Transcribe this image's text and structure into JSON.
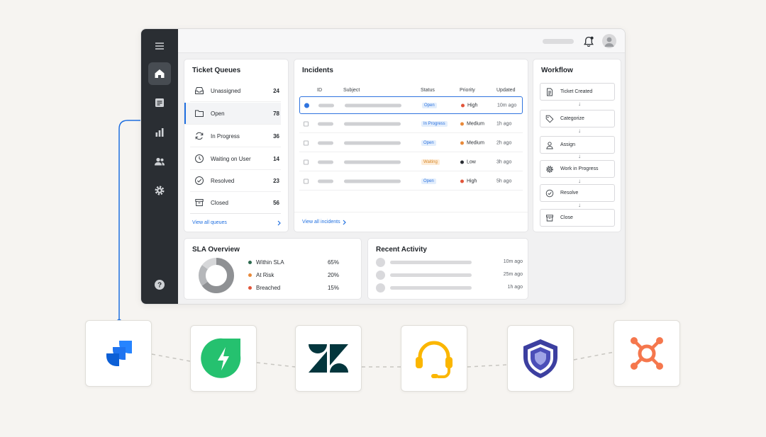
{
  "queues": {
    "title": "Ticket Queues",
    "items": [
      {
        "label": "Unassigned",
        "count": "24"
      },
      {
        "label": "Open",
        "count": "78"
      },
      {
        "label": "In Progress",
        "count": "36"
      },
      {
        "label": "Waiting on User",
        "count": "14"
      },
      {
        "label": "Resolved",
        "count": "23"
      },
      {
        "label": "Closed",
        "count": "56"
      }
    ],
    "view_all": "View all queues"
  },
  "incidents": {
    "title": "Incidents",
    "columns": [
      "ID",
      "Subject",
      "Status",
      "Priority",
      "Updated"
    ],
    "rows": [
      {
        "status": "Open",
        "priority": "High",
        "updated": "10m ago"
      },
      {
        "status": "In Progress",
        "priority": "Medium",
        "updated": "1h ago"
      },
      {
        "status": "Open",
        "priority": "Medium",
        "updated": "2h ago"
      },
      {
        "status": "Waiting",
        "priority": "Low",
        "updated": "3h ago"
      },
      {
        "status": "Open",
        "priority": "High",
        "updated": "5h ago"
      }
    ],
    "view_all": "View all incidents"
  },
  "workflow": {
    "title": "Workflow",
    "steps": [
      "Ticket Created",
      "Categorize",
      "Assign",
      "Work in Progress",
      "Resolve",
      "Close"
    ]
  },
  "sla": {
    "title": "SLA Overview",
    "items": [
      {
        "label": "Within SLA",
        "value": "65%",
        "fraction": 0.65,
        "color": "#2d6a4f"
      },
      {
        "label": "At Risk",
        "value": "20%",
        "fraction": 0.2,
        "color": "#e8893a"
      },
      {
        "label": "Breached",
        "value": "15%",
        "fraction": 0.15,
        "color": "#e2553a"
      }
    ]
  },
  "activity": {
    "title": "Recent Activity",
    "times": [
      "10m ago",
      "25m ago",
      "1h ago"
    ]
  },
  "colors": {
    "accent": "#1f6fe0",
    "sidebar": "#2a2e33",
    "priority_high": "#e2553a",
    "priority_medium": "#e8893a",
    "priority_low": "#2a2e33"
  },
  "integrations": [
    "jira-service-management-logo",
    "freshservice-logo",
    "zendesk-logo",
    "helpdesk-headset-logo",
    "security-shield-logo",
    "hubspot-logo"
  ]
}
